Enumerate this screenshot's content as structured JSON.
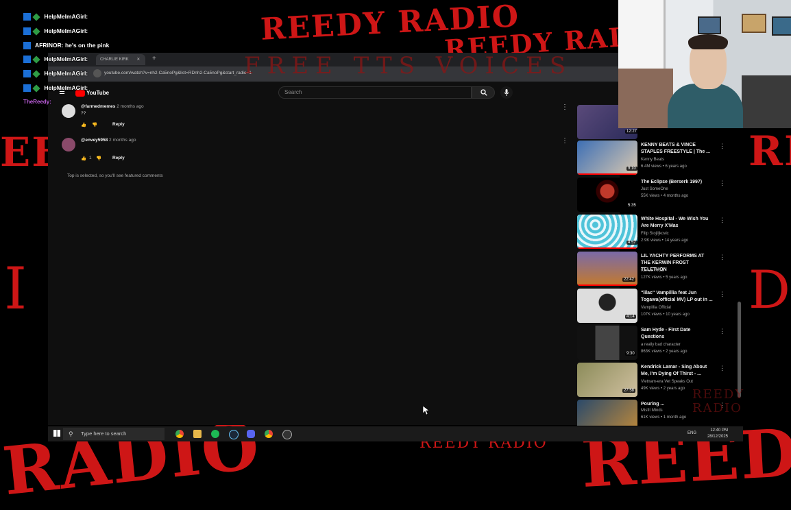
{
  "overlay": {
    "top_brand_left": "REEDY RADIO",
    "top_brand_right": "REEDY RADIO",
    "banner": "FREE TTS VOICES",
    "bottom_left": "RADIO",
    "bottom_right": "REEDY",
    "bottom_mid": "REEDY RADIO",
    "left_partial": "EE",
    "right_partial": "RE",
    "left_mid_partial": "I",
    "right_mid_partial": "D",
    "watermark": "REEDY RADIO"
  },
  "chat": [
    {
      "user": "HelpMeImAGirl:",
      "message": ""
    },
    {
      "user": "HelpMeImAGirl:",
      "message": ""
    },
    {
      "user": "AFRINOR:",
      "message": "he's on the pink"
    },
    {
      "user": "HelpMeImAGirl:",
      "message": ""
    },
    {
      "user": "HelpMeImAGirl:",
      "message": ""
    },
    {
      "user": "TheReedy:",
      "message": ""
    }
  ],
  "browser": {
    "tab_label": "CHARLIE KIRK",
    "url": "youtube.com/watch?v=nh2-Ca5noPg&list=RDnh2-Ca5noPg&start_radio=1"
  },
  "youtube": {
    "logo": "YouTube",
    "search_placeholder": "Search",
    "comments": [
      {
        "handle": "@farmedmemes",
        "time": "2 months ago",
        "text": "??",
        "likes": "",
        "reply": "Reply"
      },
      {
        "handle": "@envey5958",
        "time": "2 months ago",
        "text": "",
        "likes": "1",
        "reply": "Reply"
      }
    ],
    "featured_note": "Top is selected, so you'll see featured comments"
  },
  "recommended": [
    {
      "title": "",
      "channel": "",
      "meta": "",
      "duration": "12:27"
    },
    {
      "title": "KENNY BEATS & VINCE STAPLES FREESTYLE | The ...",
      "channel": "Kenny Beats",
      "meta": "6.4M views • 6 years ago",
      "duration": "9:10"
    },
    {
      "title": "The Eclipse (Berserk 1997)",
      "channel": "Just SomeOne",
      "meta": "55K views • 4 months ago",
      "duration": "5:35"
    },
    {
      "title": "White Hospital - We Wish You Are Merry X'Mas",
      "channel": "Filip Stojiljkovic",
      "meta": "2.9K views • 14 years ago",
      "duration": "4:57"
    },
    {
      "title": "LIL YACHTY PERFORMS AT THE KERWIN FROST TELETHON",
      "channel": "Kerwin Frost",
      "meta": "127K views • 5 years ago",
      "duration": "22:42"
    },
    {
      "title": "\"lilac\" Vampillia feat Jun Togawa(official MV) LP out in ...",
      "channel": "Vampillia Official",
      "meta": "107K views • 10 years ago",
      "duration": "4:14"
    },
    {
      "title": "Sam Hyde - First Date Questions",
      "channel": "a really bad character",
      "meta": "863K views • 2 years ago",
      "duration": "9:30"
    },
    {
      "title": "Kendrick Lamar - Sing About Me, I'm Dying Of Thirst - ...",
      "channel": "Vietnam-era Vet Speaks Out",
      "meta": "49K views • 2 years ago",
      "duration": "27:58"
    },
    {
      "title": "Pouring ...",
      "channel": "Misfit Minds",
      "meta": "61K views • 1 month ago",
      "duration": ""
    }
  ],
  "taskbar": {
    "search_placeholder": "Type here to search",
    "time": "12:40 PM",
    "date": "28/12/2025",
    "lang": "ENG"
  }
}
